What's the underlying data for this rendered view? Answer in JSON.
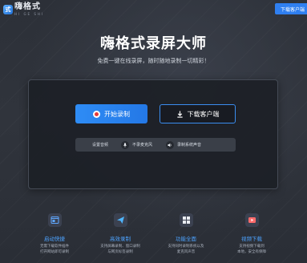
{
  "header": {
    "logo_mark": "式",
    "logo_name": "嗨格式",
    "logo_sub": "HI GE SHI",
    "download_button": "下载客户端"
  },
  "hero": {
    "title": "嗨格式录屏大师",
    "subtitle": "免费一键在线录屏，随时随地录制一切精彩！"
  },
  "panel": {
    "start_record": "开始录制",
    "download_client": "下载客户端",
    "settings_label": "设置音频",
    "mic_label": "不录麦克风",
    "system_audio_label": "录制系统声音"
  },
  "features": [
    {
      "icon": "window-icon",
      "title": "启动快捷",
      "desc": [
        "无需下载软件插件",
        "打开网站即可录制"
      ],
      "color": "#5fa8ff"
    },
    {
      "icon": "send-icon",
      "title": "高效录制",
      "desc": [
        "支持屏幕录制、窗口录制",
        "与网页标签录制"
      ],
      "color": "#4fb6ff"
    },
    {
      "icon": "grid-icon",
      "title": "功能全面",
      "desc": [
        "支持同时录制系统以及",
        "麦克风声音"
      ],
      "color": "#e9ecf2"
    },
    {
      "icon": "video-icon",
      "title": "视频下载",
      "desc": [
        "支持视频下载到",
        "本地，安全有保障"
      ],
      "color": "#ff6b6b"
    }
  ],
  "colors": {
    "accent": "#2f7ff0",
    "feature_title": "#4da3ff",
    "record_dot": "#e83a3a"
  }
}
